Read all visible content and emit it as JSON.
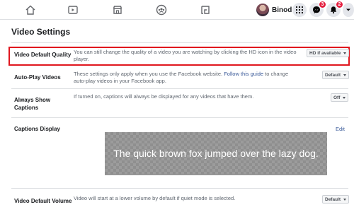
{
  "topbar": {
    "nav_icons": [
      "home-icon",
      "watch-icon",
      "marketplace-icon",
      "groups-icon",
      "gaming-icon"
    ],
    "profile_name": "Binod",
    "menu_icon": "grid-menu-icon",
    "messenger_badge": "3",
    "notifications_badge": "2",
    "account_icon": "chevron-down-icon",
    "badge_color": "#e41e3f"
  },
  "page": {
    "title": "Video Settings"
  },
  "rows": [
    {
      "label": "Video Default Quality",
      "description": "You can still change the quality of a video you are watching by clicking the HD icon in the video player.",
      "dropdown": "HD if available"
    },
    {
      "label": "Auto-Play Videos",
      "description_before": "These settings only apply when you use the Facebook website. ",
      "description_link": "Follow this guide",
      "description_after": " to change auto-play videos in your Facebook app.",
      "dropdown": "Default"
    },
    {
      "label": "Always Show Captions",
      "description": "If turned on, captions will always be displayed for any videos that have them.",
      "dropdown": "Off"
    },
    {
      "label": "Captions Display",
      "edit_label": "Edit",
      "preview_text": "The quick brown fox jumped over the lazy dog."
    },
    {
      "label": "Video Default Volume",
      "description": "Video will start at a lower volume by default if quiet mode is selected.",
      "dropdown": "Default"
    }
  ],
  "colors": {
    "highlight": "#e0161e",
    "link": "#385898"
  }
}
